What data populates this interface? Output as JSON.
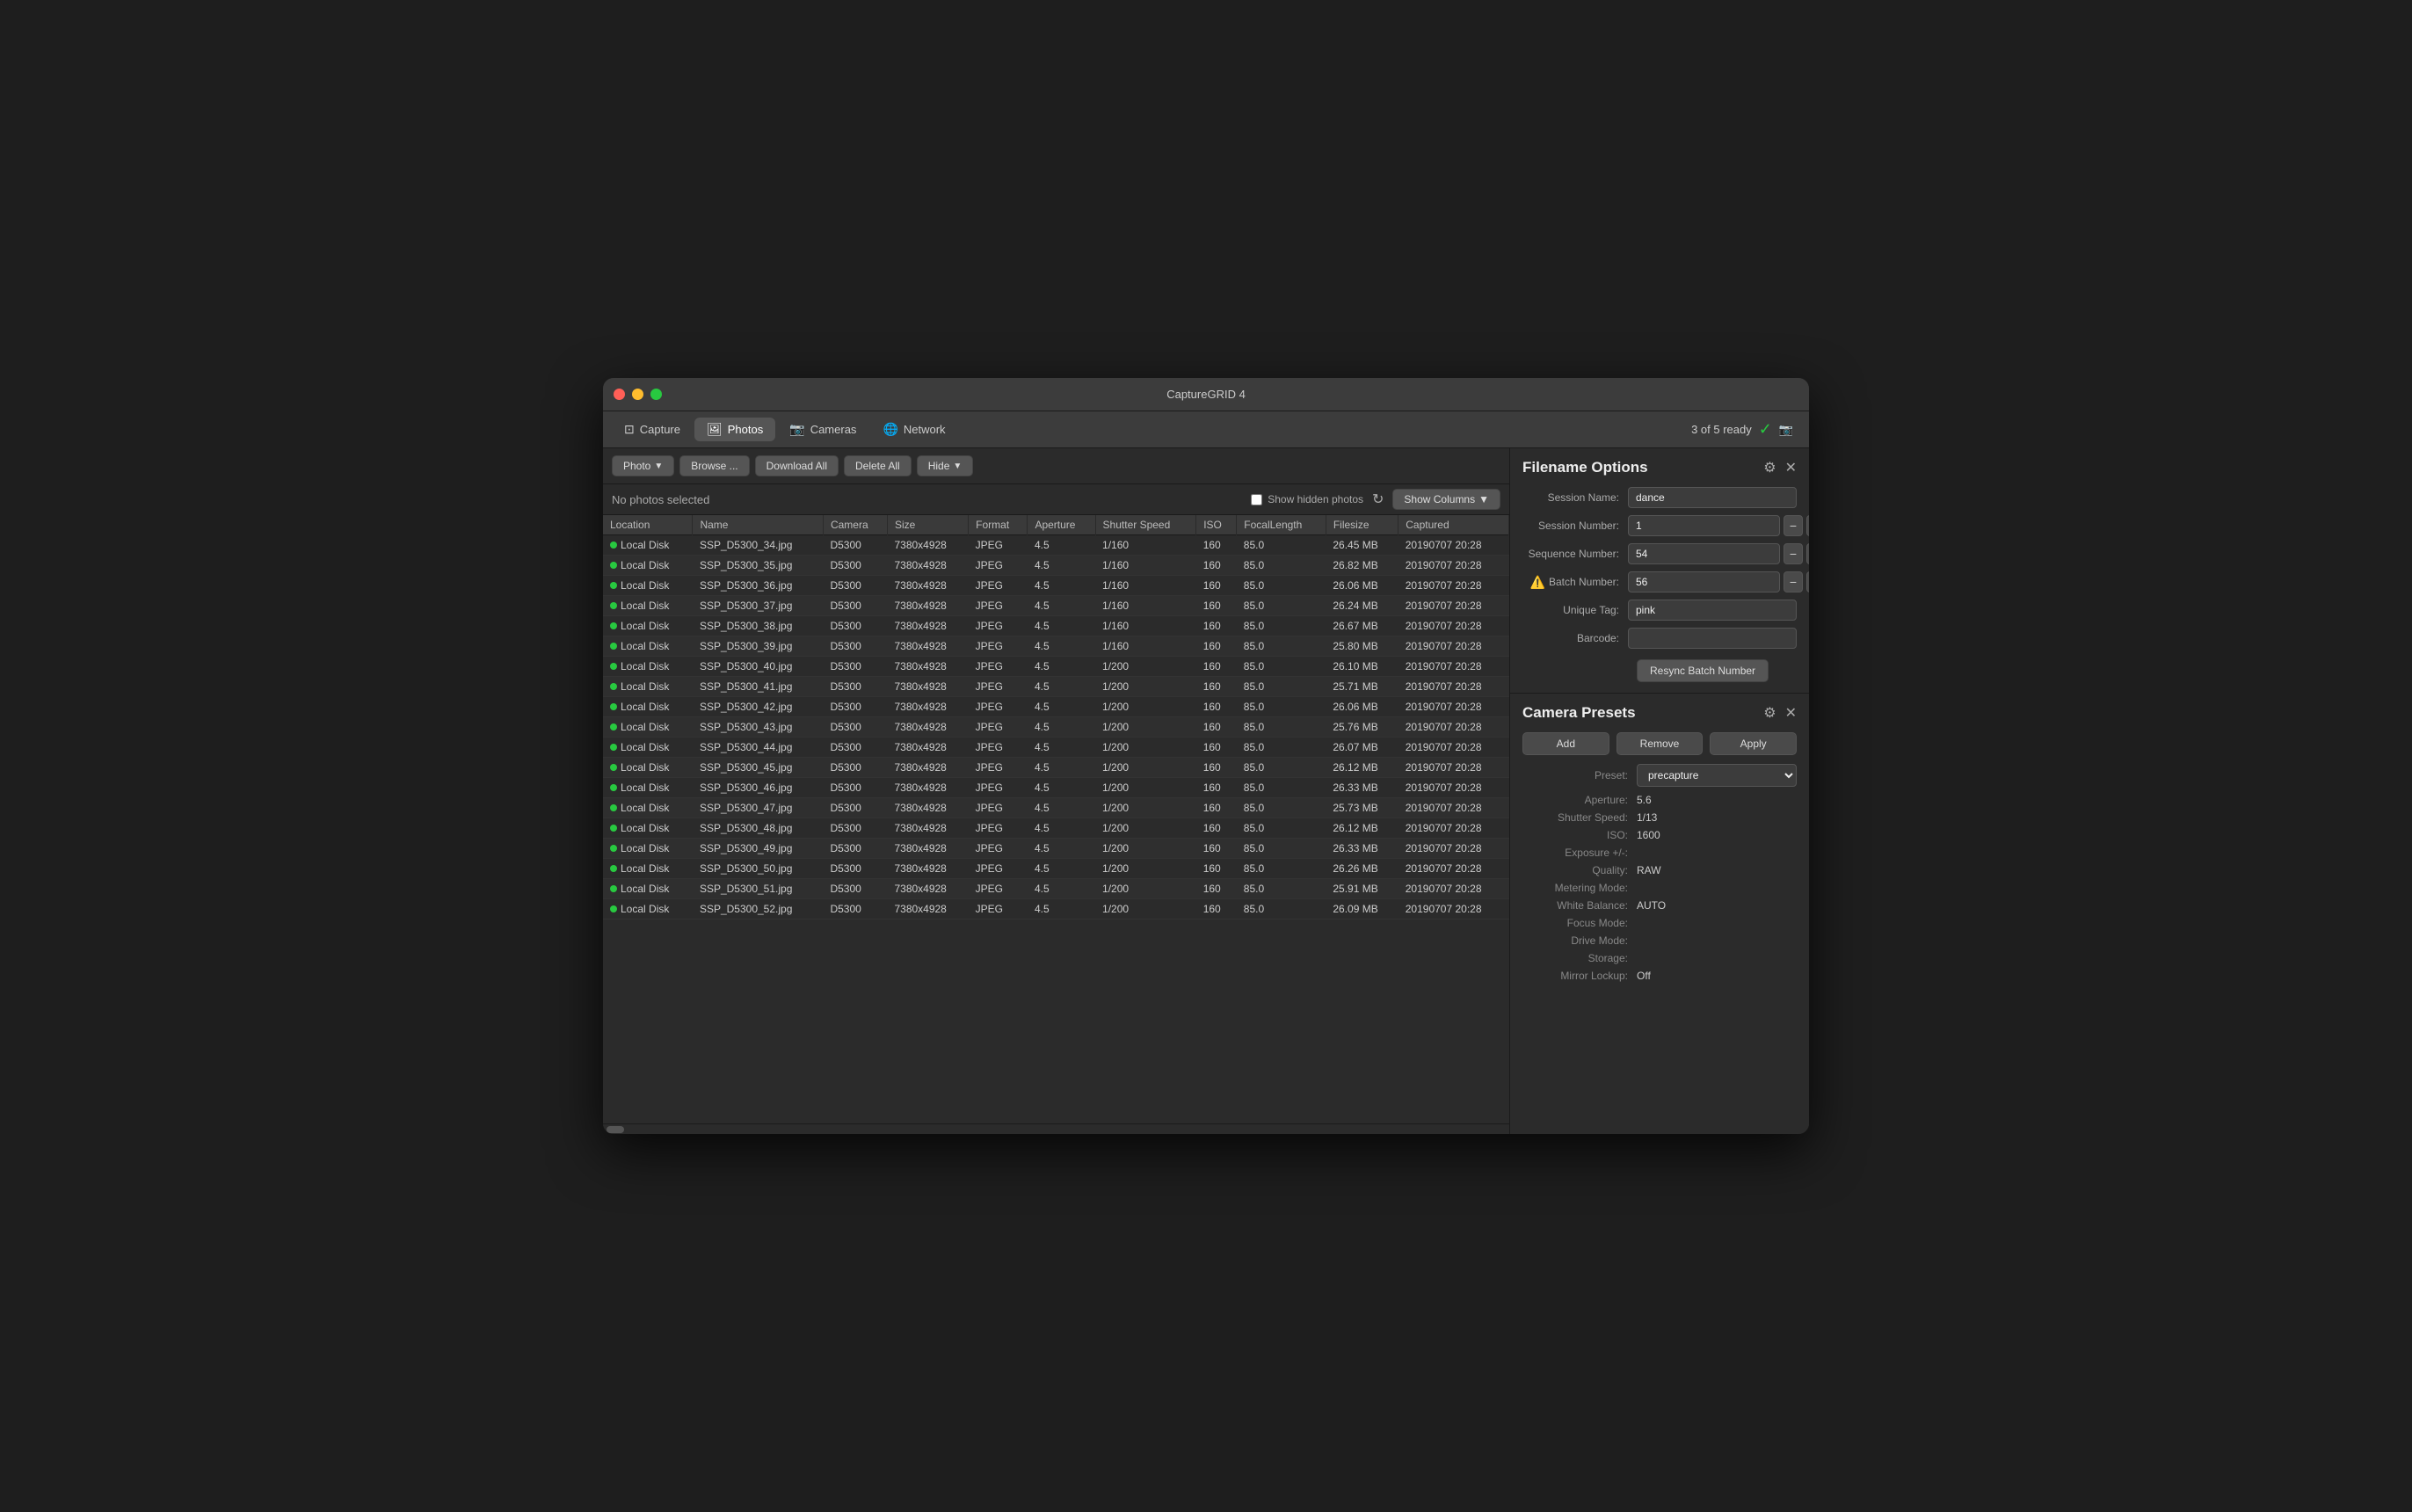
{
  "window": {
    "title": "CaptureGRID 4"
  },
  "tabs": [
    {
      "id": "capture",
      "label": "Capture",
      "icon": "⊡",
      "active": false
    },
    {
      "id": "photos",
      "label": "Photos",
      "icon": "🖼",
      "active": true
    },
    {
      "id": "cameras",
      "label": "Cameras",
      "icon": "📷",
      "active": false
    },
    {
      "id": "network",
      "label": "Network",
      "icon": "🌐",
      "active": false
    }
  ],
  "status": {
    "text": "3 of 5 ready",
    "check": "✓",
    "camera_icon": "📷"
  },
  "toolbar": {
    "photo_btn": "Photo",
    "browse_btn": "Browse ...",
    "download_all_btn": "Download All",
    "delete_all_btn": "Delete All",
    "hide_btn": "Hide"
  },
  "filter": {
    "no_selection": "No photos selected",
    "show_hidden": "Show hidden photos",
    "show_columns": "Show Columns"
  },
  "table": {
    "columns": [
      "Location",
      "Name",
      "Camera",
      "Size",
      "Format",
      "Aperture",
      "Shutter Speed",
      "ISO",
      "FocalLength",
      "Filesize",
      "Captured"
    ],
    "rows": [
      [
        "Local Disk",
        "SSP_D5300_34.jpg",
        "D5300",
        "7380x4928",
        "JPEG",
        "4.5",
        "1/160",
        "160",
        "85.0",
        "26.45 MB",
        "20190707 20:28"
      ],
      [
        "Local Disk",
        "SSP_D5300_35.jpg",
        "D5300",
        "7380x4928",
        "JPEG",
        "4.5",
        "1/160",
        "160",
        "85.0",
        "26.82 MB",
        "20190707 20:28"
      ],
      [
        "Local Disk",
        "SSP_D5300_36.jpg",
        "D5300",
        "7380x4928",
        "JPEG",
        "4.5",
        "1/160",
        "160",
        "85.0",
        "26.06 MB",
        "20190707 20:28"
      ],
      [
        "Local Disk",
        "SSP_D5300_37.jpg",
        "D5300",
        "7380x4928",
        "JPEG",
        "4.5",
        "1/160",
        "160",
        "85.0",
        "26.24 MB",
        "20190707 20:28"
      ],
      [
        "Local Disk",
        "SSP_D5300_38.jpg",
        "D5300",
        "7380x4928",
        "JPEG",
        "4.5",
        "1/160",
        "160",
        "85.0",
        "26.67 MB",
        "20190707 20:28"
      ],
      [
        "Local Disk",
        "SSP_D5300_39.jpg",
        "D5300",
        "7380x4928",
        "JPEG",
        "4.5",
        "1/160",
        "160",
        "85.0",
        "25.80 MB",
        "20190707 20:28"
      ],
      [
        "Local Disk",
        "SSP_D5300_40.jpg",
        "D5300",
        "7380x4928",
        "JPEG",
        "4.5",
        "1/200",
        "160",
        "85.0",
        "26.10 MB",
        "20190707 20:28"
      ],
      [
        "Local Disk",
        "SSP_D5300_41.jpg",
        "D5300",
        "7380x4928",
        "JPEG",
        "4.5",
        "1/200",
        "160",
        "85.0",
        "25.71 MB",
        "20190707 20:28"
      ],
      [
        "Local Disk",
        "SSP_D5300_42.jpg",
        "D5300",
        "7380x4928",
        "JPEG",
        "4.5",
        "1/200",
        "160",
        "85.0",
        "26.06 MB",
        "20190707 20:28"
      ],
      [
        "Local Disk",
        "SSP_D5300_43.jpg",
        "D5300",
        "7380x4928",
        "JPEG",
        "4.5",
        "1/200",
        "160",
        "85.0",
        "25.76 MB",
        "20190707 20:28"
      ],
      [
        "Local Disk",
        "SSP_D5300_44.jpg",
        "D5300",
        "7380x4928",
        "JPEG",
        "4.5",
        "1/200",
        "160",
        "85.0",
        "26.07 MB",
        "20190707 20:28"
      ],
      [
        "Local Disk",
        "SSP_D5300_45.jpg",
        "D5300",
        "7380x4928",
        "JPEG",
        "4.5",
        "1/200",
        "160",
        "85.0",
        "26.12 MB",
        "20190707 20:28"
      ],
      [
        "Local Disk",
        "SSP_D5300_46.jpg",
        "D5300",
        "7380x4928",
        "JPEG",
        "4.5",
        "1/200",
        "160",
        "85.0",
        "26.33 MB",
        "20190707 20:28"
      ],
      [
        "Local Disk",
        "SSP_D5300_47.jpg",
        "D5300",
        "7380x4928",
        "JPEG",
        "4.5",
        "1/200",
        "160",
        "85.0",
        "25.73 MB",
        "20190707 20:28"
      ],
      [
        "Local Disk",
        "SSP_D5300_48.jpg",
        "D5300",
        "7380x4928",
        "JPEG",
        "4.5",
        "1/200",
        "160",
        "85.0",
        "26.12 MB",
        "20190707 20:28"
      ],
      [
        "Local Disk",
        "SSP_D5300_49.jpg",
        "D5300",
        "7380x4928",
        "JPEG",
        "4.5",
        "1/200",
        "160",
        "85.0",
        "26.33 MB",
        "20190707 20:28"
      ],
      [
        "Local Disk",
        "SSP_D5300_50.jpg",
        "D5300",
        "7380x4928",
        "JPEG",
        "4.5",
        "1/200",
        "160",
        "85.0",
        "26.26 MB",
        "20190707 20:28"
      ],
      [
        "Local Disk",
        "SSP_D5300_51.jpg",
        "D5300",
        "7380x4928",
        "JPEG",
        "4.5",
        "1/200",
        "160",
        "85.0",
        "25.91 MB",
        "20190707 20:28"
      ],
      [
        "Local Disk",
        "SSP_D5300_52.jpg",
        "D5300",
        "7380x4928",
        "JPEG",
        "4.5",
        "1/200",
        "160",
        "85.0",
        "26.09 MB",
        "20190707 20:28"
      ]
    ]
  },
  "filename_options": {
    "title": "Filename Options",
    "session_name_label": "Session Name:",
    "session_name_value": "dance",
    "session_number_label": "Session Number:",
    "session_number_value": "1",
    "sequence_number_label": "Sequence Number:",
    "sequence_number_value": "54",
    "batch_number_label": "Batch Number:",
    "batch_number_value": "56",
    "unique_tag_label": "Unique Tag:",
    "unique_tag_value": "pink",
    "barcode_label": "Barcode:",
    "barcode_value": "",
    "resync_btn": "Resync Batch Number"
  },
  "camera_presets": {
    "title": "Camera Presets",
    "add_btn": "Add",
    "remove_btn": "Remove",
    "apply_btn": "Apply",
    "preset_label": "Preset:",
    "preset_value": "precapture",
    "aperture_label": "Aperture:",
    "aperture_value": "5.6",
    "shutter_label": "Shutter Speed:",
    "shutter_value": "1/13",
    "iso_label": "ISO:",
    "iso_value": "1600",
    "exposure_label": "Exposure +/-:",
    "exposure_value": "",
    "quality_label": "Quality:",
    "quality_value": "RAW",
    "metering_label": "Metering Mode:",
    "metering_value": "",
    "wb_label": "White Balance:",
    "wb_value": "AUTO",
    "focus_label": "Focus Mode:",
    "focus_value": "",
    "drive_label": "Drive Mode:",
    "drive_value": "",
    "storage_label": "Storage:",
    "storage_value": "",
    "mirror_label": "Mirror Lockup:",
    "mirror_value": "Off"
  }
}
